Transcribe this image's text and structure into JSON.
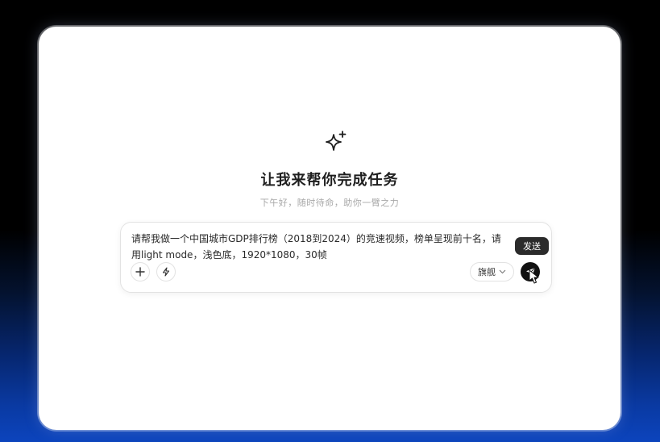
{
  "hero": {
    "icon": "sparkle-icon",
    "title": "让我来帮你完成任务",
    "subtitle": "下午好，随时待命，助你一臂之力"
  },
  "composer": {
    "prompt_text": "请帮我做一个中国城市GDP排行榜（2018到2024）的竞速视频，榜单呈现前十名，请用light mode，浅色底，1920*1080，30帧",
    "add_icon": "plus-icon",
    "quick_icon": "lightning-icon",
    "model_label": "旗舰",
    "model_chevron": "chevron-down-icon",
    "send_icon": "send-arrow-icon",
    "send_tooltip": "发送"
  },
  "colors": {
    "window_bg": "#ffffff",
    "send_button": "#111111",
    "tooltip_bg": "#2b2b2b",
    "backdrop_blue": "#0c44bd"
  }
}
